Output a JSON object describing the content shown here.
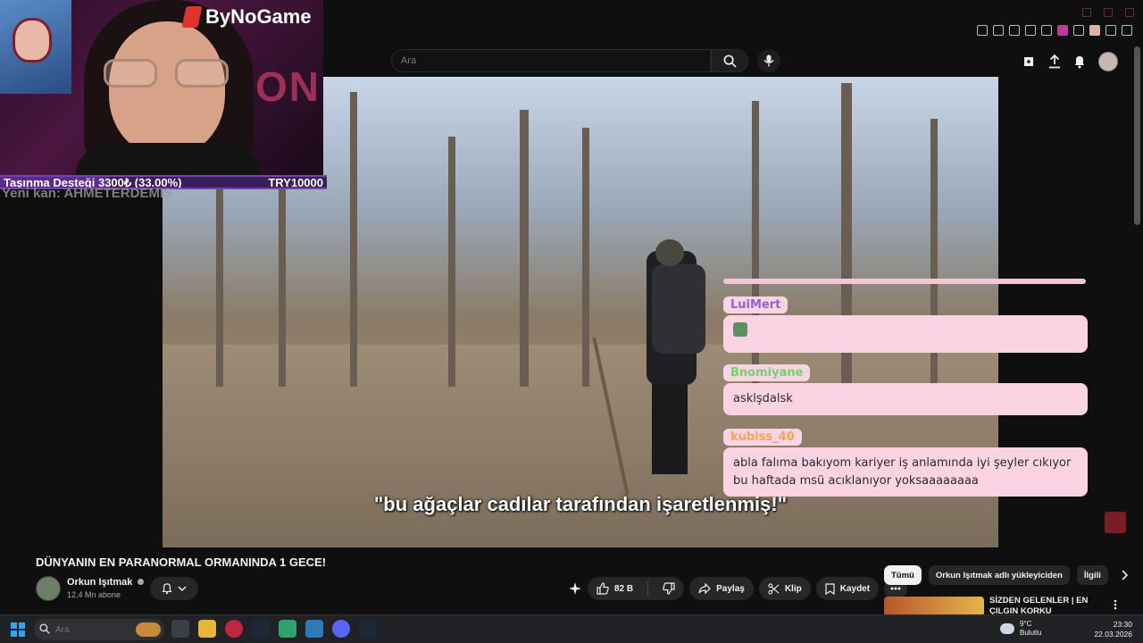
{
  "browser": {
    "extension_icons": [
      "bookmark-icon",
      "tab-icon",
      "shield-icon",
      "play-icon",
      "heart-icon",
      "puzzle-icon",
      "download-icon",
      "menu-icon"
    ]
  },
  "youtube": {
    "search": {
      "placeholder": "Ara"
    },
    "header_icons": [
      "create-icon",
      "upload-icon",
      "bell-icon",
      "avatar"
    ]
  },
  "stream": {
    "brand": "ByNoGame",
    "donation_goal": {
      "label": "Taşınma Desteği 3300₺ (33.00%)",
      "goal": "TRY10000",
      "progress": 0.33
    },
    "new_member": "Yeni kan: AHMETERDEMIS",
    "neon_sign": "ON"
  },
  "video": {
    "subtitle": "\"bu ağaçlar cadılar tarafından işaretlenmiş!\"",
    "title": "DÜNYANIN EN PARANORMAL ORMANINDA 1 GECE!",
    "channel": {
      "name": "Orkun Işıtmak",
      "subscribers": "12,4 Mn abone",
      "verified": true
    },
    "likes": "82 B",
    "actions": {
      "share": "Paylaş",
      "clip": "Klip",
      "save": "Kaydet"
    }
  },
  "chat": [
    {
      "user": "LuiMert",
      "color": "#8a68c9",
      "message": ""
    },
    {
      "user": "Bnomiyane",
      "color": "#6ed46a",
      "message": "asklşdalsk"
    },
    {
      "user": "kubiss_40",
      "color": "#f3a35a",
      "message": "abla falıma bakıyom kariyer iş anlamında iyi şeyler cıkıyor bu haftada msü acıklanıyor yoksaaaaaaaa"
    }
  ],
  "related": {
    "chips": [
      "Tümü",
      "Orkun Işıtmak adlı yükleyiciden",
      "İlgili"
    ],
    "active_chip": "Tümü",
    "first_video_title": "SİZDEN GELENLER | EN ÇILGIN KORKU HİKAYELERİNİZ!"
  },
  "taskbar": {
    "search_placeholder": "Ara",
    "weather": {
      "temp": "9°C",
      "condition": "Bulutlu"
    },
    "time": "23:30",
    "date": "22.03.2026"
  }
}
